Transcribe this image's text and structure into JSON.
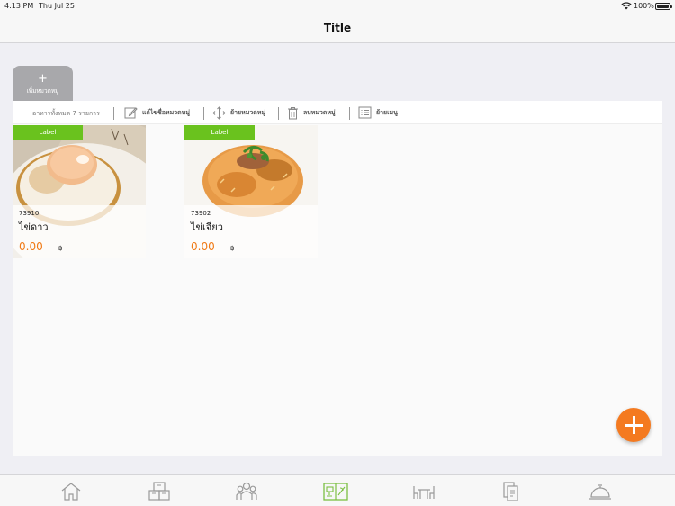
{
  "status_bar": {
    "time": "4:13 PM",
    "date": "Thu Jul 25",
    "battery_percent": "100%"
  },
  "nav": {
    "title": "Title"
  },
  "add_category": {
    "plus": "+",
    "label": "เพิ่มหมวดหมู่"
  },
  "toolbar": {
    "count_label": "อาหารทั้งหมด 7 รายการ",
    "edit_category": "แก้ไขชื่อหมวดหมู่",
    "move_category": "ย้ายหมวดหมู่",
    "delete_category": "ลบหมวดหมู่",
    "move_menu": "ย้ายเมนู"
  },
  "items": [
    {
      "tag": "Label",
      "code": "73910",
      "name": "ไข่ดาว",
      "price": "0.00",
      "currency": "฿",
      "image": "fried-egg"
    },
    {
      "tag": "Label",
      "code": "73902",
      "name": "ไข่เจียว",
      "price": "0.00",
      "currency": "฿",
      "image": "omelette-rice"
    }
  ],
  "tab_bar": {
    "tabs": [
      {
        "icon": "home-icon",
        "active": false
      },
      {
        "icon": "boxes-icon",
        "active": false
      },
      {
        "icon": "people-icon",
        "active": false
      },
      {
        "icon": "menu-book-icon",
        "active": true
      },
      {
        "icon": "tables-icon",
        "active": false
      },
      {
        "icon": "receipts-icon",
        "active": false
      },
      {
        "icon": "service-bell-icon",
        "active": false
      }
    ]
  },
  "colors": {
    "accent_green": "#6ac21e",
    "price_orange": "#f07a16",
    "fab_orange": "#f47a20",
    "tab_active": "#7cc043",
    "tab_inactive": "#9a9a9a"
  }
}
